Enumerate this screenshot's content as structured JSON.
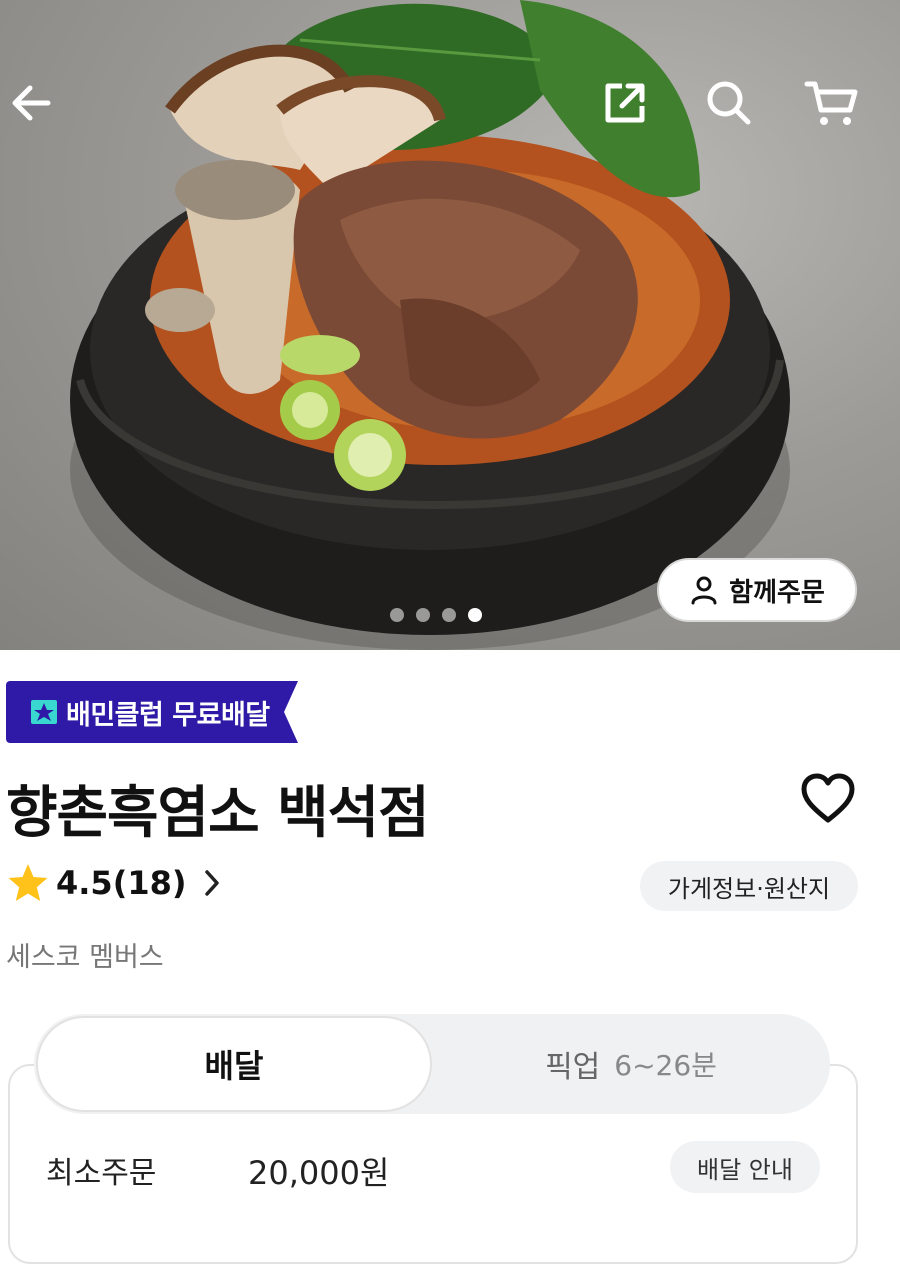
{
  "header": {
    "back_icon": "arrow-left-icon",
    "share_icon": "share-icon",
    "search_icon": "search-icon",
    "cart_icon": "cart-icon",
    "group_order_label": "함께주문",
    "carousel": {
      "total": 4,
      "active": 4
    }
  },
  "store": {
    "badge_label": "배민클럽 무료배달",
    "name": "향촌흑염소 백석점",
    "rating": "4.5(18)",
    "info_button": "가게정보·원산지",
    "subtitle": "세스코 멤버스"
  },
  "order": {
    "tab_delivery": "배달",
    "tab_pickup": "픽업",
    "pickup_time": "6~26분",
    "min_order_label": "최소주문",
    "min_order_value": "20,000원",
    "delivery_guide": "배달 안내"
  },
  "colors": {
    "badge": "#2e1aa6",
    "badge_icon": "#3ad6d0",
    "star": "#ffc21a"
  }
}
